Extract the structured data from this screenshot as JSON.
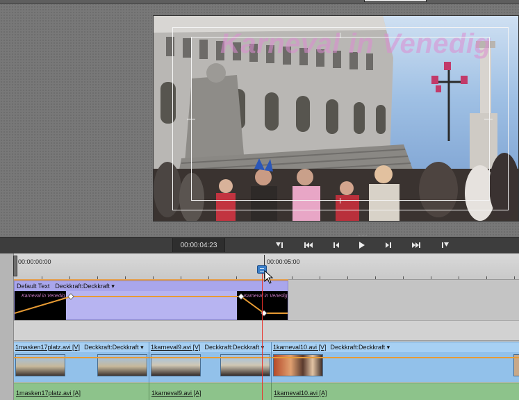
{
  "monitor": {
    "overlay_title": "Karneval in Venedig"
  },
  "transport": {
    "timecode": "00:00:04:23",
    "buttons": [
      {
        "id": "set-in",
        "icon": "set-in-point-icon"
      },
      {
        "id": "go-to-start",
        "icon": "skip-to-start-icon"
      },
      {
        "id": "step-back",
        "icon": "step-back-icon"
      },
      {
        "id": "play",
        "icon": "play-icon"
      },
      {
        "id": "step-forward",
        "icon": "step-forward-icon"
      },
      {
        "id": "go-to-end",
        "icon": "skip-to-end-icon"
      },
      {
        "id": "set-out",
        "icon": "set-out-point-icon"
      }
    ]
  },
  "ruler": {
    "start_label": "00:00:00:00",
    "mark_label": "00:00:05:00"
  },
  "title_track": {
    "clip_name": "Default Text",
    "property": "Deckkraft:Deckkraft",
    "thumb_text": "Karneval in Venedig"
  },
  "video_track": {
    "clips": [
      {
        "name": "1masken17platz.avi [V]",
        "property": "Deckkraft:Deckkraft"
      },
      {
        "name": "1karneval9.avi [V]",
        "property": "Deckkraft:Deckkraft"
      },
      {
        "name": "1karneval10.avi [V]",
        "property": "Deckkraft:Deckkraft"
      }
    ]
  },
  "audio_track": {
    "clips": [
      {
        "name": "1masken17platz.avi [A]"
      },
      {
        "name": "1karneval9.avi [A]"
      },
      {
        "name": "1karneval10.avi [A]"
      }
    ]
  },
  "colors": {
    "playhead": "#e8312a",
    "keyframe_line": "#e79b34",
    "title_clip": "#b7b4f1",
    "video_clip": "#92c1ea",
    "audio_clip": "#8dc38b"
  }
}
